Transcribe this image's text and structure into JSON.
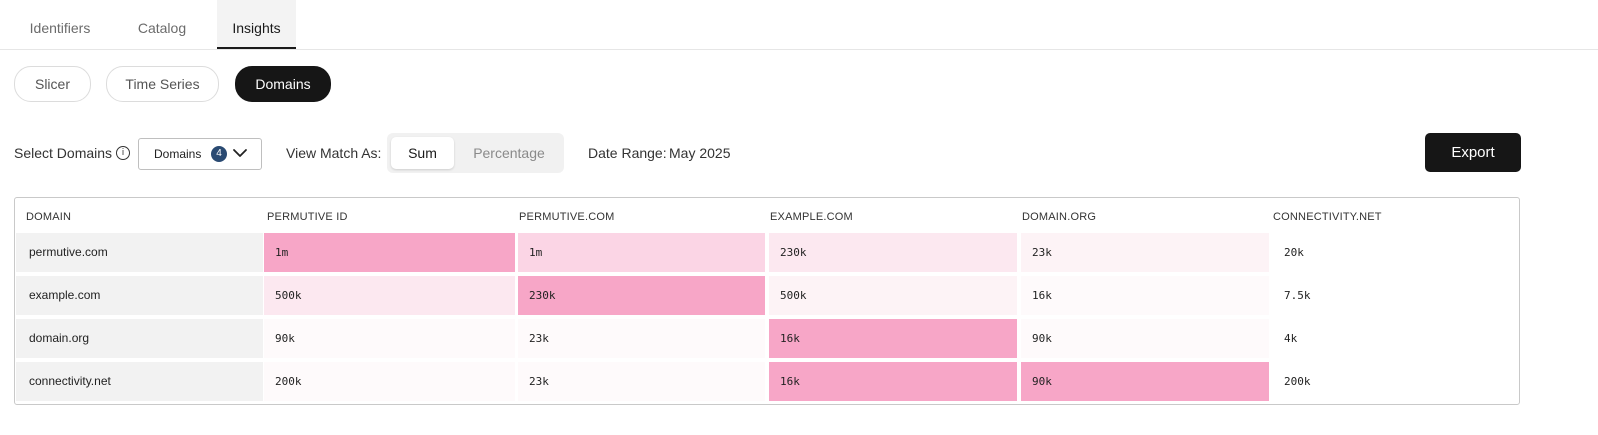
{
  "tabs": [
    "Identifiers",
    "Catalog",
    "Insights"
  ],
  "active_tab": "Insights",
  "pills": [
    "Slicer",
    "Time Series",
    "Domains"
  ],
  "active_pill": "Domains",
  "controls": {
    "select_domains_label": "Select Domains",
    "info_icon": "info-icon",
    "domains_select_text": "Domains",
    "domains_select_count": "4",
    "view_match_label": "View Match As:",
    "view_options": [
      "Sum",
      "Percentage"
    ],
    "view_selected": "Sum",
    "date_range_label": "Date Range:",
    "date_range_value": "May 2025",
    "export_label": "Export"
  },
  "colors": {
    "pink_strong": "#f7a6c7",
    "pink_medium": "#fbd5e5",
    "pink_light": "#fce8f0",
    "pink_faint": "#fdf3f6",
    "pink_faintest": "#fefafb",
    "domain_cell": "#f2f2f2",
    "dark": "#161616"
  },
  "table": {
    "headers": [
      "DOMAIN",
      "PERMUTIVE ID",
      "PERMUTIVE.COM",
      "EXAMPLE.COM",
      "DOMAIN.ORG",
      "CONNECTIVITY.NET"
    ],
    "rows": [
      {
        "domain": "permutive.com",
        "values": [
          "1m",
          "1m",
          "230k",
          "23k",
          "20k"
        ]
      },
      {
        "domain": "example.com",
        "values": [
          "500k",
          "230k",
          "500k",
          "16k",
          "7.5k"
        ]
      },
      {
        "domain": "domain.org",
        "values": [
          "90k",
          "23k",
          "16k",
          "90k",
          "4k"
        ]
      },
      {
        "domain": "connectivity.net",
        "values": [
          "200k",
          "23k",
          "16k",
          "90k",
          "200k"
        ]
      }
    ],
    "cell_tints": [
      [
        "gray",
        "strong",
        "medium",
        "light",
        "faint"
      ],
      [
        "gray",
        "light",
        "strong",
        "faint",
        "faintest"
      ],
      [
        "gray",
        "faintest",
        "faintest",
        "strong",
        "faintest"
      ],
      [
        "gray",
        "faintest",
        "faintest",
        "strong",
        "strong"
      ]
    ]
  }
}
